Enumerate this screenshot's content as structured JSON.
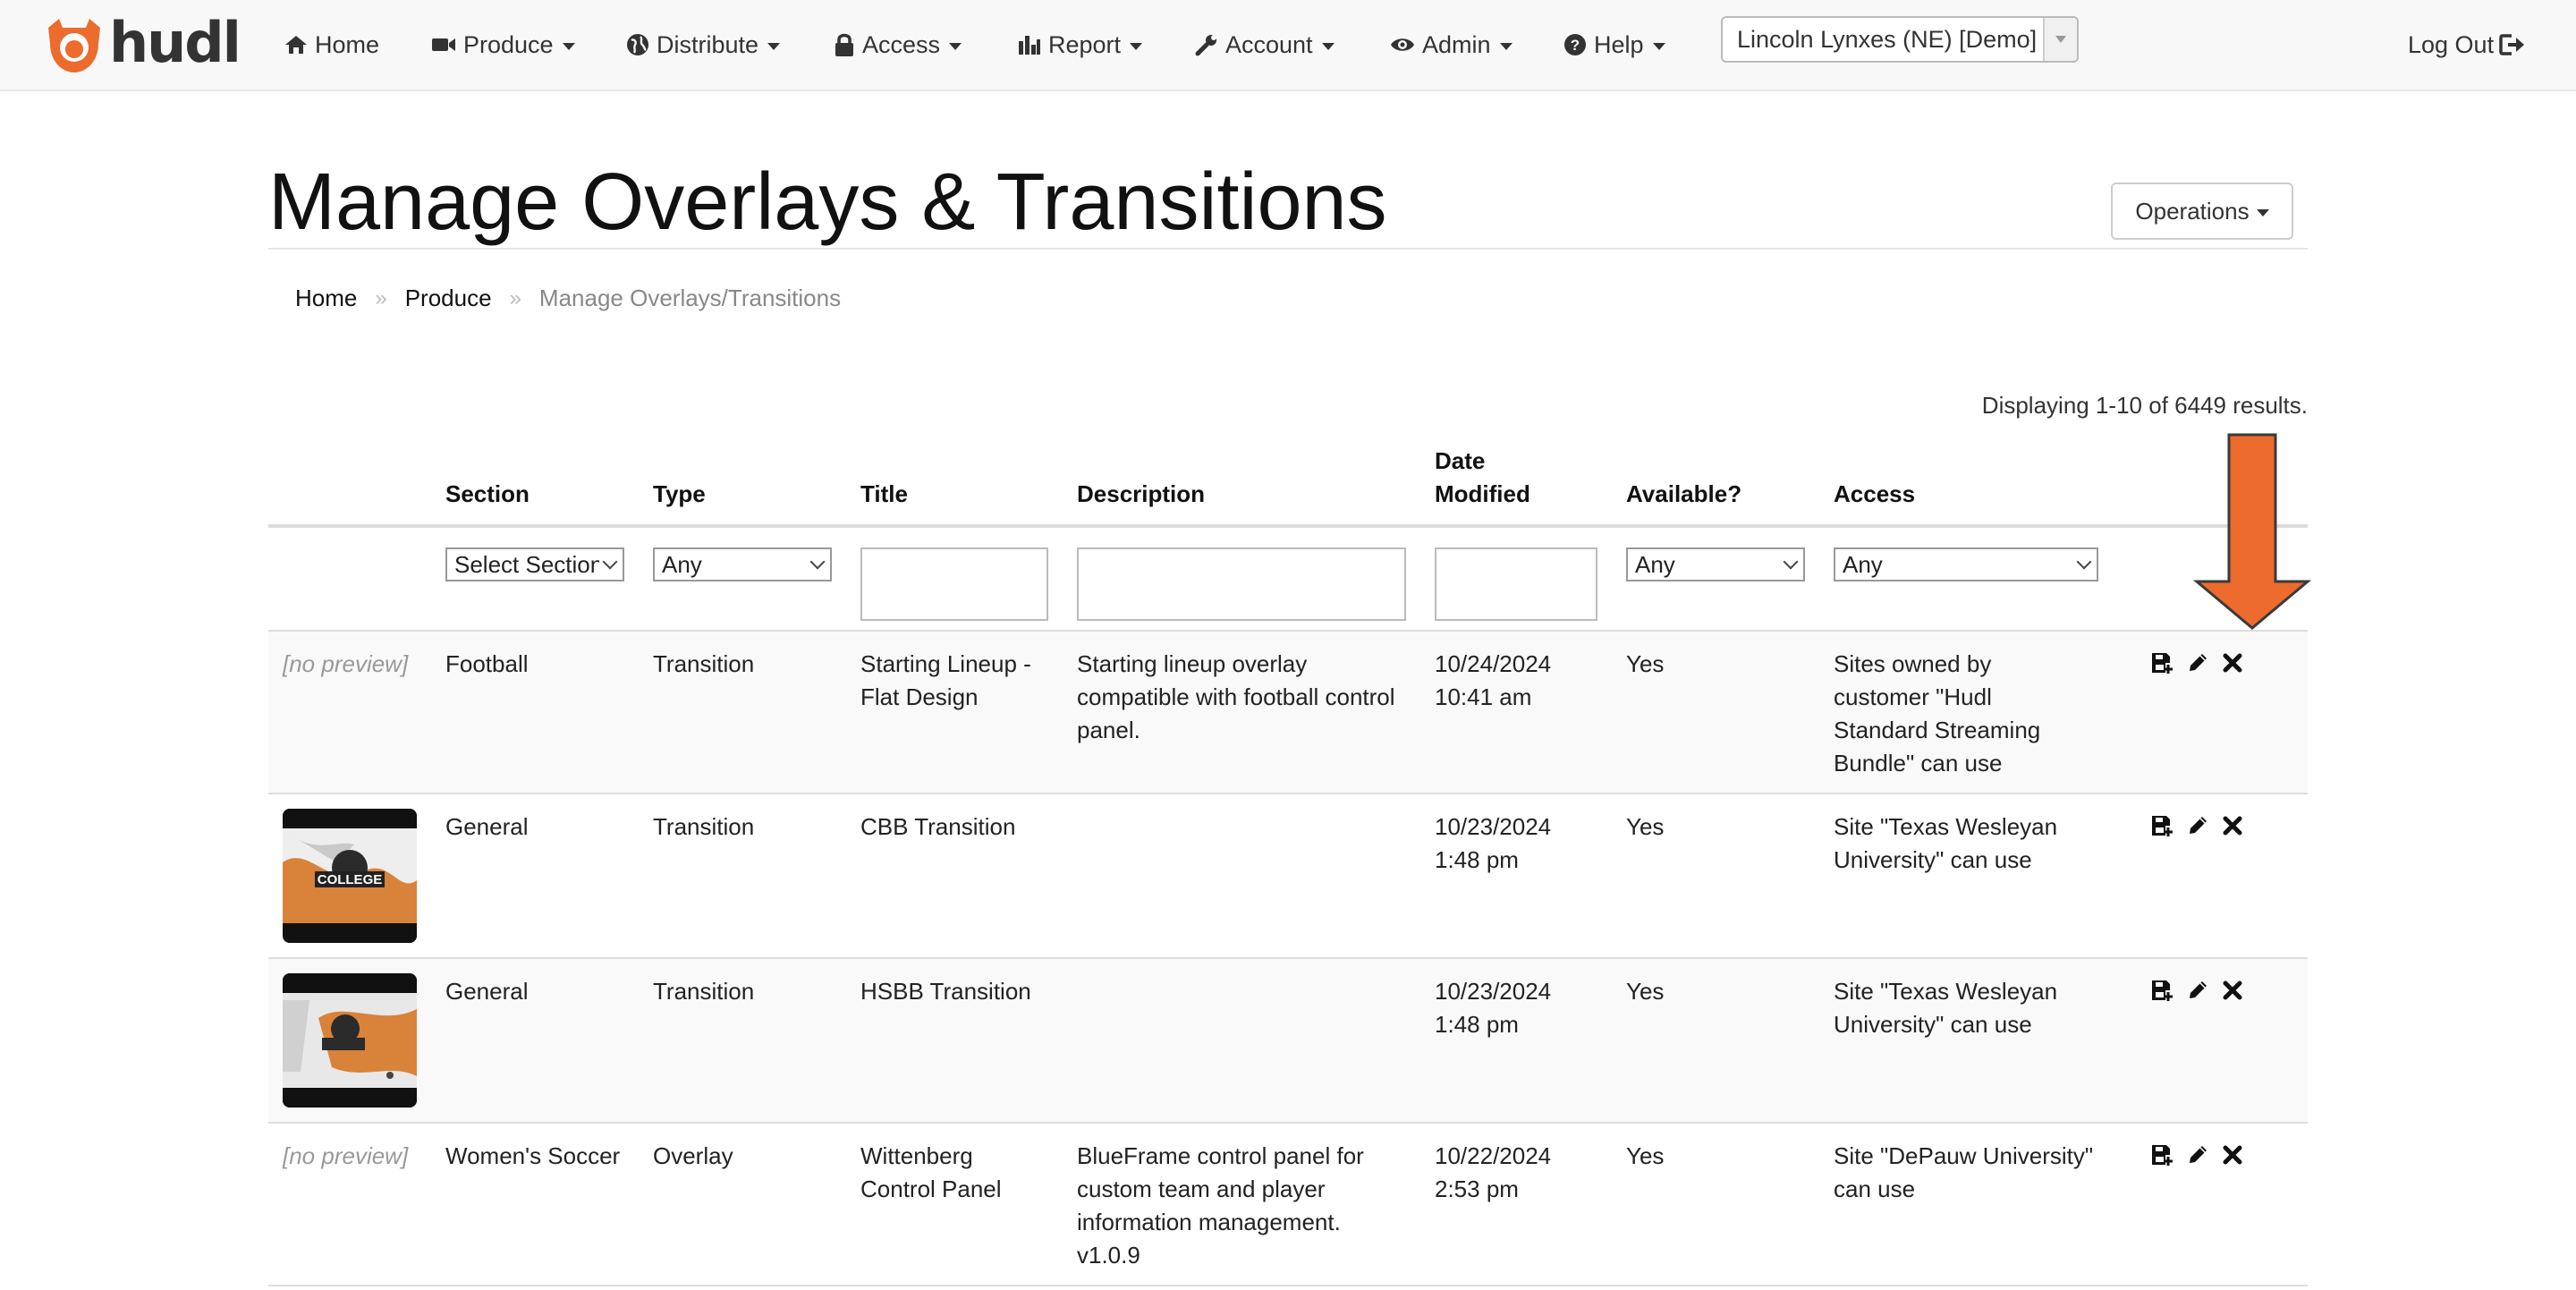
{
  "nav": {
    "brand": "hudl",
    "items": [
      {
        "label": "Home",
        "icon": "home-icon",
        "dropdown": false
      },
      {
        "label": "Produce",
        "icon": "video-camera-icon",
        "dropdown": true
      },
      {
        "label": "Distribute",
        "icon": "globe-icon",
        "dropdown": true
      },
      {
        "label": "Access",
        "icon": "lock-icon",
        "dropdown": true
      },
      {
        "label": "Report",
        "icon": "bar-chart-icon",
        "dropdown": true
      },
      {
        "label": "Account",
        "icon": "wrench-icon",
        "dropdown": true
      },
      {
        "label": "Admin",
        "icon": "eye-icon",
        "dropdown": true
      },
      {
        "label": "Help",
        "icon": "question-circle-icon",
        "dropdown": true
      }
    ],
    "site_selector": "Lincoln Lynxes (NE) [Demo]",
    "logout": "Log Out"
  },
  "page": {
    "title": "Manage Overlays & Transitions",
    "operations_button": "Operations",
    "breadcrumb": [
      "Home",
      "Produce",
      "Manage Overlays/Transitions"
    ],
    "summary": "Displaying 1-10 of 6449 results."
  },
  "table": {
    "headers": {
      "section": "Section",
      "type": "Type",
      "title": "Title",
      "description": "Description",
      "date_line1": "Date",
      "date_line2": "Modified",
      "available": "Available?",
      "access": "Access"
    },
    "filters": {
      "section": "Select Section",
      "type": "Any",
      "available": "Any",
      "access": "Any"
    },
    "rows": [
      {
        "preview": "[no preview]",
        "section": "Football",
        "type": "Transition",
        "title": "Starting Lineup - Flat Design",
        "description": "Starting lineup overlay compatible with football control panel.",
        "date": "10/24/2024",
        "time": "10:41 am",
        "available": "Yes",
        "access": "Sites owned by customer \"Hudl Standard Streaming Bundle\" can use"
      },
      {
        "preview_label": "COLLEGE",
        "section": "General",
        "type": "Transition",
        "title": "CBB Transition",
        "description": "",
        "date": "10/23/2024",
        "time": "1:48 pm",
        "available": "Yes",
        "access": "Site \"Texas Wesleyan University\" can use"
      },
      {
        "section": "General",
        "type": "Transition",
        "title": "HSBB Transition",
        "description": "",
        "date": "10/23/2024",
        "time": "1:48 pm",
        "available": "Yes",
        "access": "Site \"Texas Wesleyan University\" can use"
      },
      {
        "preview": "[no preview]",
        "section": "Women's Soccer",
        "type": "Overlay",
        "title": "Wittenberg Control Panel",
        "description": "BlueFrame control panel for custom team and player information management. v1.0.9",
        "date": "10/22/2024",
        "time": "2:53 pm",
        "available": "Yes",
        "access": "Site \"DePauw University\" can use"
      }
    ]
  },
  "colors": {
    "brand_orange": "#ec6b2d",
    "navbar_bg": "#f8f8f8",
    "row_stripe": "#f9f9f9"
  }
}
